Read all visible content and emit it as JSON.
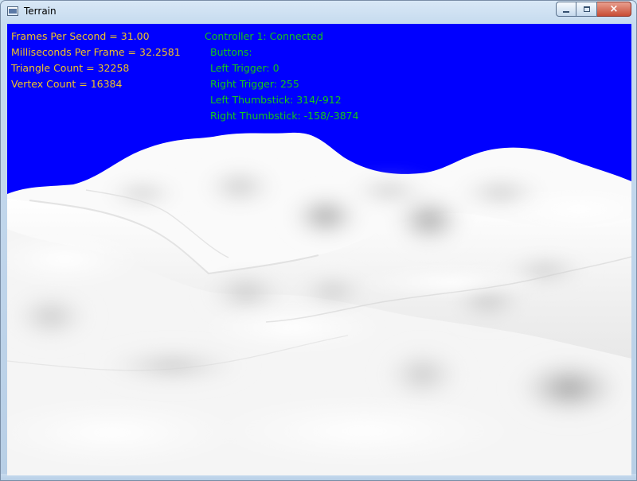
{
  "window": {
    "title": "Terrain",
    "icon": "application-window-icon"
  },
  "caption_buttons": {
    "minimize": "minimize-icon",
    "maximize": "maximize-icon",
    "close": "close-icon",
    "close_label": "×"
  },
  "stats": [
    "Frames Per Second = 31.00",
    "Milliseconds Per Frame = 32.2581",
    "Triangle Count = 32258",
    "Vertex Count = 16384"
  ],
  "controller": {
    "status": "Controller 1: Connected",
    "buttons": "Buttons:",
    "left_trigger": "Left Trigger: 0",
    "right_trigger": "Right Trigger: 255",
    "left_thumbstick": "Left Thumbstick: 314/-912",
    "right_thumbstick": "Right Thumbstick: -158/-3874"
  },
  "colors": {
    "sky": "#0000ff",
    "stats_text": "#f2c32f",
    "controller_text": "#13c623",
    "terrain": "#f6f6f6"
  }
}
